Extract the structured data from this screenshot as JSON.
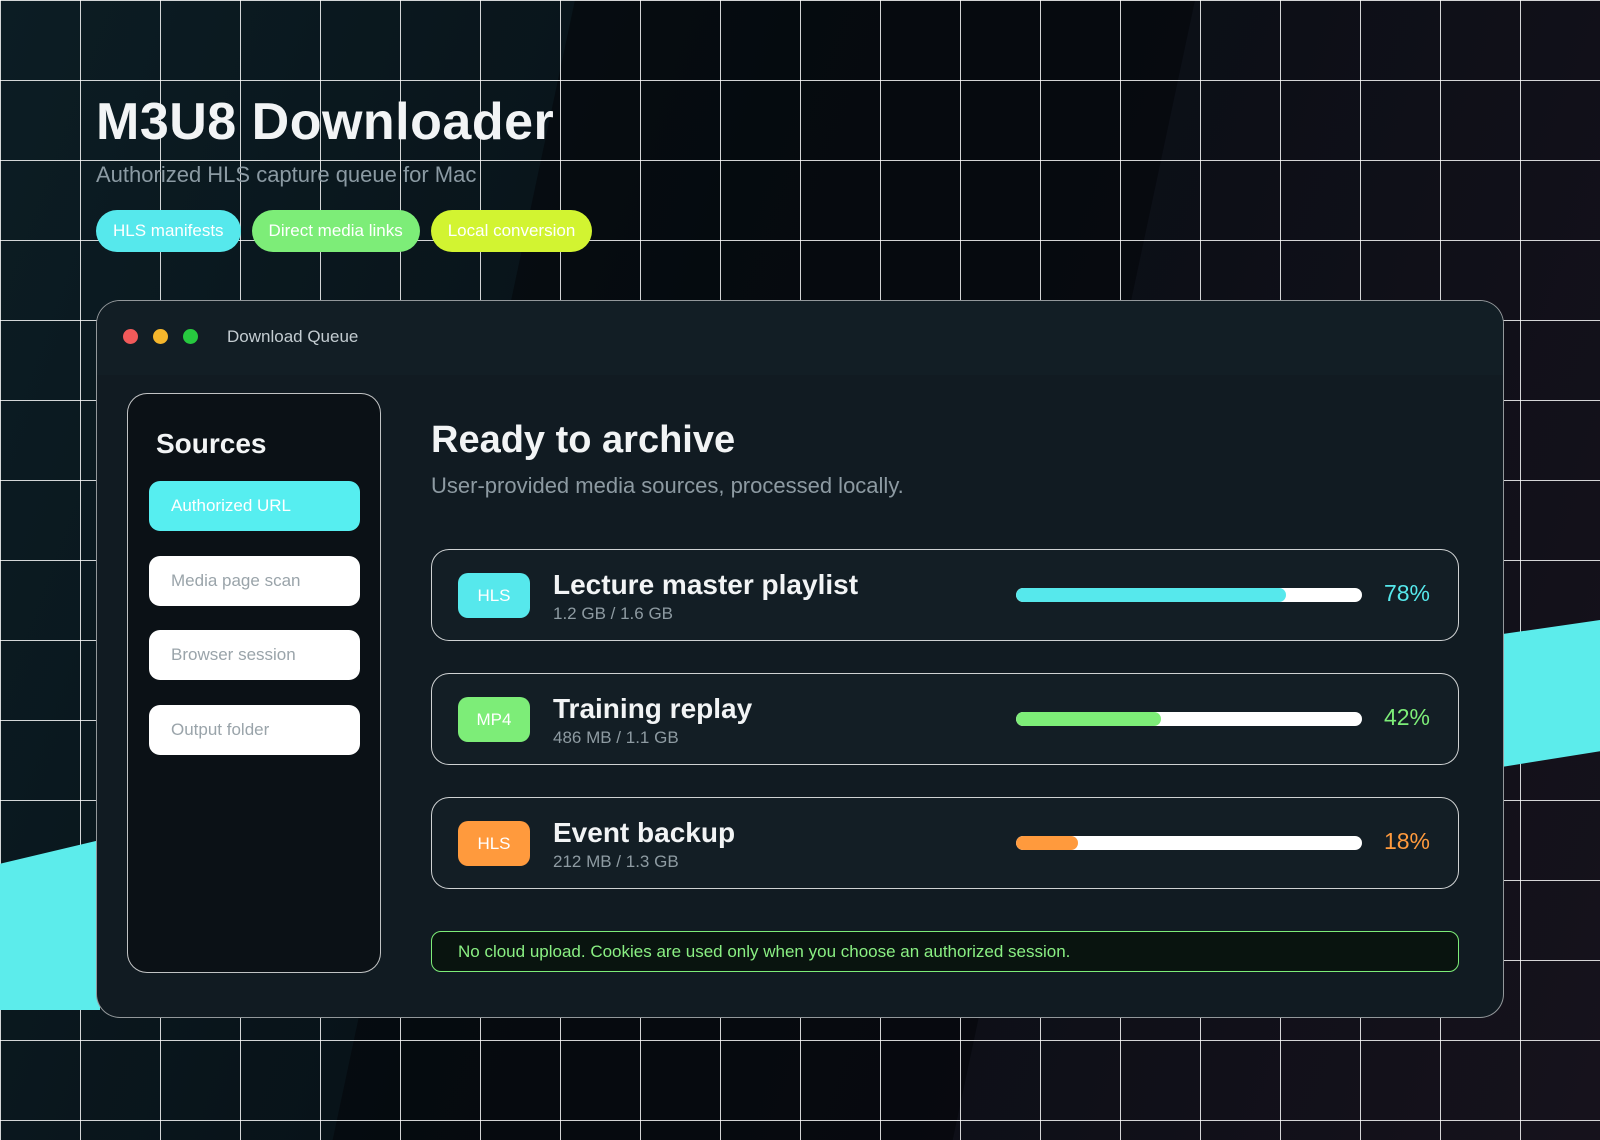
{
  "hero": {
    "title": "M3U8 Downloader",
    "subtitle": "Authorized HLS capture queue for Mac",
    "chips": [
      {
        "label": "HLS manifests",
        "color": "#56e8ec"
      },
      {
        "label": "Direct media links",
        "color": "#7ded78"
      },
      {
        "label": "Local conversion",
        "color": "#d2f431"
      }
    ]
  },
  "window": {
    "title": "Download Queue",
    "controls": [
      "close",
      "minimize",
      "zoom"
    ]
  },
  "sidebar": {
    "heading": "Sources",
    "items": [
      {
        "label": "Authorized URL",
        "active": true
      },
      {
        "label": "Media page scan",
        "active": false
      },
      {
        "label": "Browser session",
        "active": false
      },
      {
        "label": "Output folder",
        "active": false
      }
    ]
  },
  "main": {
    "title": "Ready to archive",
    "subtitle": "User-provided media sources, processed locally.",
    "jobs": [
      {
        "badge": "HLS",
        "name": "Lecture master playlist",
        "size": "1.2 GB / 1.6 GB",
        "progress": 78,
        "progress_label": "78%",
        "color": "#56e8ec"
      },
      {
        "badge": "MP4",
        "name": "Training replay",
        "size": "486 MB / 1.1 GB",
        "progress": 42,
        "progress_label": "42%",
        "color": "#7ded78"
      },
      {
        "badge": "HLS",
        "name": "Event backup",
        "size": "212 MB / 1.3 GB",
        "progress": 18,
        "progress_label": "18%",
        "color": "#ff9a3d"
      }
    ],
    "notice": "No cloud upload. Cookies are used only when you choose an authorized session."
  }
}
